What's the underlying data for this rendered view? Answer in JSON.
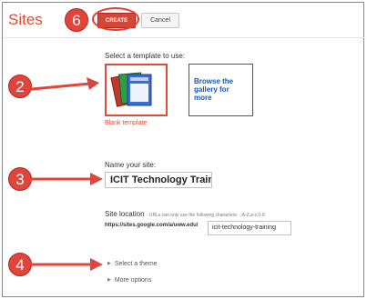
{
  "header": {
    "title": "Sites",
    "create_label": "CREATE",
    "cancel_label": "Cancel"
  },
  "callouts": {
    "step6": "6",
    "step2": "2",
    "step3": "3",
    "step4": "4"
  },
  "template": {
    "prompt": "Select a template to use:",
    "blank_caption": "Blank template",
    "browse_label": "Browse the gallery for more"
  },
  "site_name": {
    "label": "Name your site:",
    "value": "ICIT Technology Training"
  },
  "site_location": {
    "label": "Site location",
    "hint": "- URLs can only use the following characters: -,A-Z,a-z,0-9",
    "prefix": "https://sites.google.com/a/uww.edu/",
    "value": "icit-technology-training"
  },
  "options": {
    "theme_label": "Select a theme",
    "more_label": "More options"
  },
  "colors": {
    "accent": "#dd4b39",
    "callout": "#e0443a",
    "link": "#1155cc"
  }
}
